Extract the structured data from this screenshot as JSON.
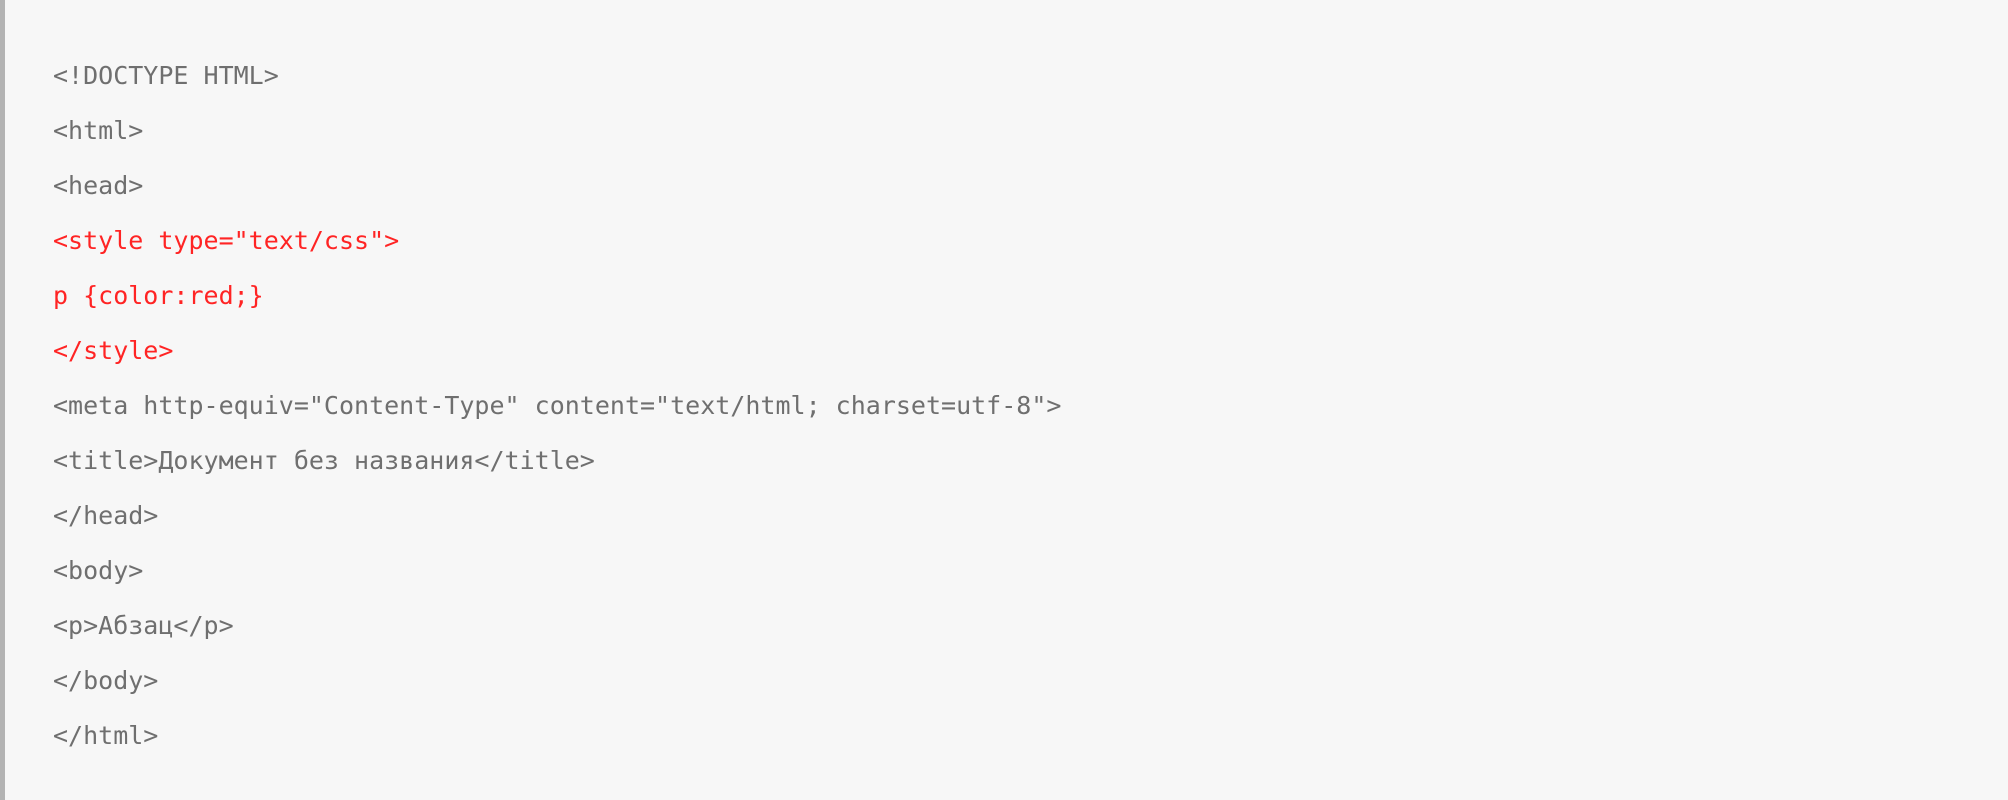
{
  "code": {
    "lines": [
      "<!DOCTYPE HTML>",
      "<html>",
      "<head>",
      "<style type=\"text/css\">",
      "p {color:red;}",
      "</style>",
      "<meta http-equiv=\"Content-Type\" content=\"text/html; charset=utf-8\">",
      "<title>Документ без названия</title>",
      "</head>",
      "<body>",
      "<p>Абзац</p>",
      "</body>",
      "</html>"
    ],
    "highlighted_line_indices": [
      3,
      4,
      5
    ]
  }
}
